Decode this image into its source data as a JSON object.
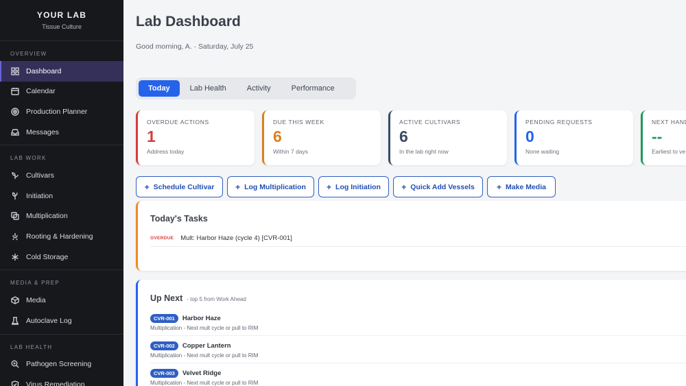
{
  "brand": {
    "name": "YOUR LAB",
    "subtitle": "Tissue Culture"
  },
  "sidebar": {
    "sections": [
      {
        "title": "OVERVIEW",
        "items": [
          {
            "label": "Dashboard",
            "icon": "grid-icon",
            "active": true
          },
          {
            "label": "Calendar",
            "icon": "calendar-icon"
          },
          {
            "label": "Production Planner",
            "icon": "target-icon"
          },
          {
            "label": "Messages",
            "icon": "inbox-icon"
          }
        ]
      },
      {
        "title": "LAB WORK",
        "items": [
          {
            "label": "Cultivars",
            "icon": "sprout-icon"
          },
          {
            "label": "Initiation",
            "icon": "seedling-icon"
          },
          {
            "label": "Multiplication",
            "icon": "copy-icon"
          },
          {
            "label": "Rooting & Hardening",
            "icon": "root-icon"
          },
          {
            "label": "Cold Storage",
            "icon": "snowflake-icon"
          }
        ]
      },
      {
        "title": "MEDIA & PREP",
        "items": [
          {
            "label": "Media",
            "icon": "cube-icon"
          },
          {
            "label": "Autoclave Log",
            "icon": "autoclave-icon"
          }
        ]
      },
      {
        "title": "LAB HEALTH",
        "items": [
          {
            "label": "Pathogen Screening",
            "icon": "magnifier-icon"
          },
          {
            "label": "Virus Remediation",
            "icon": "shield-icon"
          }
        ]
      }
    ]
  },
  "header": {
    "title": "Lab Dashboard",
    "greeting": "Good morning, A. · Saturday, July 25"
  },
  "tabs": [
    "Today",
    "Lab Health",
    "Activity",
    "Performance"
  ],
  "stats": [
    {
      "label": "OVERDUE ACTIONS",
      "value": "1",
      "sub": "Address today",
      "color": "#d63c3c"
    },
    {
      "label": "DUE THIS WEEK",
      "value": "6",
      "sub": "Within 7 days",
      "color": "#d9821c"
    },
    {
      "label": "ACTIVE CULTIVARS",
      "value": "6",
      "sub": "In the lab right now",
      "color": "#3b4a63"
    },
    {
      "label": "PENDING REQUESTS",
      "value": "0",
      "sub": "None waiting",
      "color": "#2563eb"
    },
    {
      "label": "NEXT HAND",
      "value": "--",
      "sub": "Earliest to ve",
      "color": "#1f9a5a"
    }
  ],
  "actions": [
    "Schedule Cultivar",
    "Log Multiplication",
    "Log Initiation",
    "Quick Add Vessels",
    "Make Media"
  ],
  "today_tasks": {
    "title": "Today's Tasks",
    "accent": "#f08a24",
    "items": [
      {
        "tag": "OVERDUE",
        "text": "Mult: Harbor Haze (cycle 4) [CVR-001]"
      }
    ]
  },
  "up_next": {
    "title": "Up Next",
    "subtitle": "- top 5 from Work Ahead",
    "accent": "#2563eb",
    "items": [
      {
        "code": "CVR-001",
        "name": "Harbor Haze",
        "desc": "Multiplication - Next mult cycle or pull to RIM"
      },
      {
        "code": "CVR-002",
        "name": "Copper Lantern",
        "desc": "Multiplication - Next mult cycle or pull to RIM"
      },
      {
        "code": "CVR-003",
        "name": "Velvet Ridge",
        "desc": "Multiplication - Next mult cycle or pull to RIM"
      }
    ]
  }
}
